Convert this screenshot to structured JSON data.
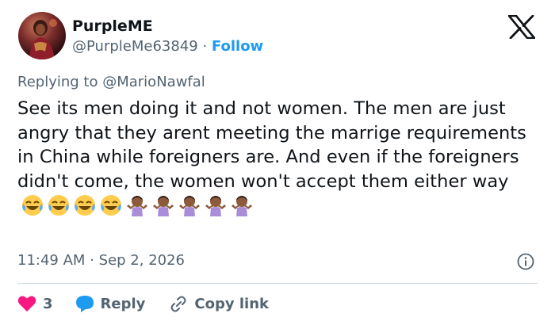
{
  "author": {
    "name": "PurpleME",
    "handle": "@PurpleMe63849",
    "separator": "·",
    "follow_label": "Follow"
  },
  "reply": {
    "prefix": "Replying to",
    "target": "@MarioNawfal"
  },
  "tweet": {
    "text": "See its men doing it and not women. The men are just angry that they arent meeting the marrige requirements in China while foreigners are. And even if the foreigners didn't come, the women won't accept them either way",
    "emojis": [
      "face-with-tears-of-joy",
      "face-with-tears-of-joy",
      "face-with-tears-of-joy",
      "face-with-tears-of-joy",
      "person-shrugging",
      "person-shrugging",
      "person-shrugging",
      "person-shrugging",
      "person-shrugging"
    ]
  },
  "meta": {
    "time": "11:49 AM",
    "separator": "·",
    "date": "Sep 2, 2026"
  },
  "actions": {
    "like_count": "3",
    "reply_label": "Reply",
    "copy_link_label": "Copy link"
  },
  "colors": {
    "accent": "#1d9bf0",
    "like": "#f91880",
    "muted": "#536471",
    "text": "#0f1419"
  },
  "icons": [
    "x-logo-icon",
    "info-icon",
    "heart-icon",
    "reply-bubble-icon",
    "link-icon"
  ]
}
